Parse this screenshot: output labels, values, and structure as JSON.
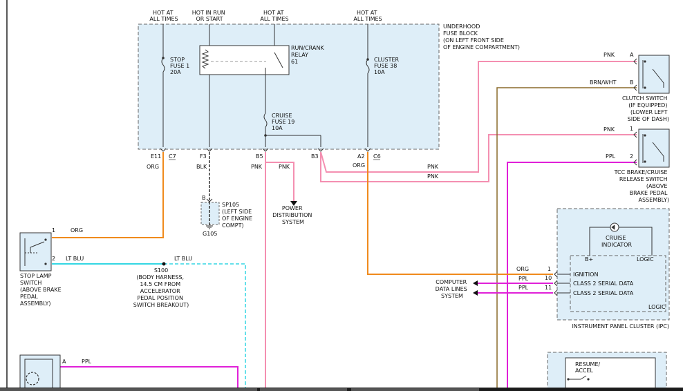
{
  "colors": {
    "PNK": "#f48fb1",
    "ORG": "#f08a1c",
    "LT_BLU": "#33d6e3",
    "PPL": "#e020d8",
    "BRN_WHT": "#8a6a2a",
    "BLK": "#333333",
    "box_fill": "#deeef8"
  },
  "top_labels": {
    "hot1": [
      "HOT AT",
      "ALL TIMES"
    ],
    "hot_run": [
      "HOT IN RUN",
      "OR START"
    ],
    "hot2": [
      "HOT AT",
      "ALL TIMES"
    ],
    "hot3": [
      "HOT AT",
      "ALL TIMES"
    ]
  },
  "fuse_block": {
    "label": [
      "UNDERHOOD",
      "FUSE BLOCK",
      "(ON LEFT FRONT SIDE",
      "OF ENGINE COMPARTMENT)"
    ],
    "stop_fuse": [
      "STOP",
      "FUSE 1",
      "20A"
    ],
    "relay": [
      "RUN/CRANK",
      "RELAY",
      "61"
    ],
    "cluster_fuse": [
      "CLUSTER",
      "FUSE 38",
      "10A"
    ],
    "cruise_fuse": [
      "CRUISE",
      "FUSE 19",
      "10A"
    ]
  },
  "pins": {
    "e11": "E11",
    "c7": "C7",
    "f3": "F3",
    "b5": "B5",
    "b3": "B3",
    "a2": "A2",
    "c6": "C6"
  },
  "wires": {
    "org": "ORG",
    "blk": "BLK",
    "pnk": "PNK",
    "lt_blu": "LT BLU",
    "ppl": "PPL",
    "brn_wht": "BRN/WHT"
  },
  "splice": {
    "pin": "B",
    "label": [
      "SP105",
      "(LEFT SIDE",
      "OF ENGINE",
      "COMPT)"
    ],
    "ground": "G105"
  },
  "power_dist": [
    "POWER",
    "DISTRIBUTION",
    "SYSTEM"
  ],
  "clutch_switch": {
    "pin_a": "A",
    "pin_b": "B",
    "label": [
      "CLUTCH SWITCH",
      "(IF EQUIPPED)",
      "(LOWER LEFT",
      "SIDE OF DASH)"
    ]
  },
  "tcc_switch": {
    "pin1": "1",
    "pin2": "2",
    "label": [
      "TCC BRAKE/CRUISE",
      "RELEASE SWITCH",
      "(ABOVE",
      "BRAKE PEDAL",
      "ASSEMBLY)"
    ]
  },
  "stop_lamp_switch": {
    "pin1": "1",
    "pin2": "2",
    "label": [
      "STOP LAMP",
      "SWITCH",
      "(ABOVE BRAKE",
      "PEDAL",
      "ASSEMBLY)"
    ]
  },
  "s100": {
    "name": "S100",
    "label": [
      "(BODY HARNESS,",
      "14.5 CM FROM",
      "ACCELERATOR",
      "PEDAL POSITION",
      "SWITCH BREAKOUT)"
    ]
  },
  "ipc": {
    "cruise_indicator": [
      "CRUISE",
      "INDICATOR"
    ],
    "b_plus": "B+",
    "logic": "LOGIC",
    "pin1": "1",
    "pin10": "10",
    "pin11": "11",
    "ignition": "IGNITION",
    "class2_a": "CLASS 2 SERIAL DATA",
    "class2_b": "CLASS 2 SERIAL DATA",
    "logic_bottom": "LOGIC",
    "name": "INSTRUMENT PANEL CLUSTER (IPC)"
  },
  "computer_data": [
    "COMPUTER",
    "DATA LINES",
    "SYSTEM"
  ],
  "bottom_left": {
    "pin_a": "A"
  },
  "resume": [
    "RESUME/",
    "ACCEL"
  ]
}
